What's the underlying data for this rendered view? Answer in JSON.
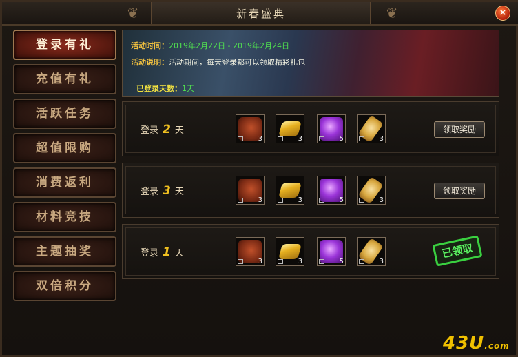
{
  "window": {
    "title": "新春盛典",
    "close_label": "×"
  },
  "sidebar": {
    "items": [
      {
        "label": "登录有礼",
        "active": true
      },
      {
        "label": "充值有礼",
        "active": false
      },
      {
        "label": "活跃任务",
        "active": false
      },
      {
        "label": "超值限购",
        "active": false
      },
      {
        "label": "消费返利",
        "active": false
      },
      {
        "label": "材料竞技",
        "active": false
      },
      {
        "label": "主题抽奖",
        "active": false
      },
      {
        "label": "双倍积分",
        "active": false
      }
    ]
  },
  "banner": {
    "time_label": "活动时间：",
    "time_value": "2019年2月22日 - 2019年2月24日",
    "desc_label": "活动说明：",
    "desc_value": "活动期间，每天登录都可以领取精彩礼包",
    "days_label": "已登录天数：",
    "days_value": "1天"
  },
  "rewards": [
    {
      "prefix": "登录",
      "day": "2",
      "suffix": "天",
      "items": [
        {
          "icon": "red-blade-icon",
          "count": "3"
        },
        {
          "icon": "gold-ingot-icon",
          "count": "3"
        },
        {
          "icon": "purple-orb-icon",
          "count": "5"
        },
        {
          "icon": "gold-token-icon",
          "count": "3"
        }
      ],
      "action": "领取奖励",
      "claimed": false
    },
    {
      "prefix": "登录",
      "day": "3",
      "suffix": "天",
      "items": [
        {
          "icon": "red-blade-icon",
          "count": "3"
        },
        {
          "icon": "gold-ingot-icon",
          "count": "3"
        },
        {
          "icon": "purple-orb-icon",
          "count": "5"
        },
        {
          "icon": "gold-token-icon",
          "count": "3"
        }
      ],
      "action": "领取奖励",
      "claimed": false
    },
    {
      "prefix": "登录",
      "day": "1",
      "suffix": "天",
      "items": [
        {
          "icon": "red-blade-icon",
          "count": "3"
        },
        {
          "icon": "gold-ingot-icon",
          "count": "3"
        },
        {
          "icon": "purple-orb-icon",
          "count": "5"
        },
        {
          "icon": "gold-token-icon",
          "count": "3"
        }
      ],
      "action": "已领取",
      "claimed": true
    }
  ],
  "watermark": {
    "main": "43U",
    "sub": ".com"
  },
  "colors": {
    "accent_gold": "#f0c020",
    "date_green": "#50e050",
    "claimed_green": "#3ad040",
    "active_tab": "#8a2a1c"
  }
}
